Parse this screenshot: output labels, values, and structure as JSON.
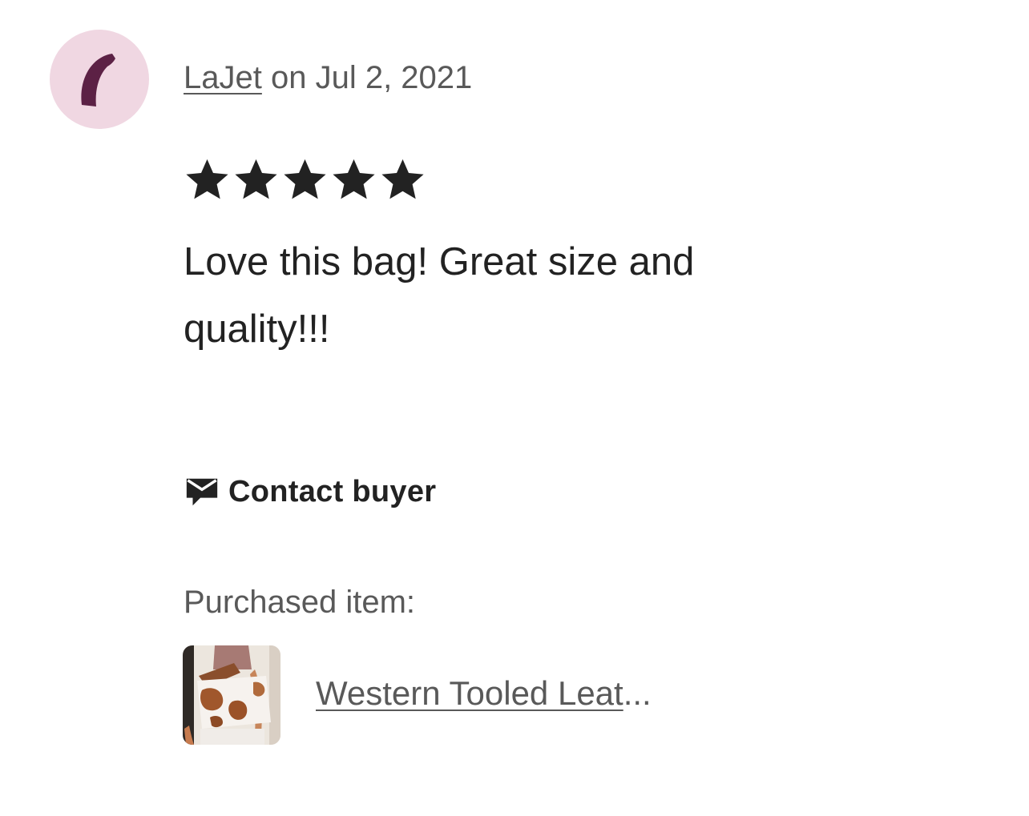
{
  "review": {
    "author": "LaJet",
    "date_text": " on Jul 2, 2021",
    "rating": 5,
    "rating_max": 5,
    "text": "Love this bag! Great size and quality!!!",
    "avatar": {
      "background": "#f0d7e2",
      "mark_color": "#5c2145"
    }
  },
  "contact": {
    "label": "Contact buyer",
    "icon": "message-icon"
  },
  "purchase": {
    "label": "Purchased item:",
    "item_title": "Western Tooled Leat",
    "ellipsis": "..."
  },
  "colors": {
    "text_primary": "#222222",
    "text_secondary": "#595959",
    "star": "#222222"
  }
}
